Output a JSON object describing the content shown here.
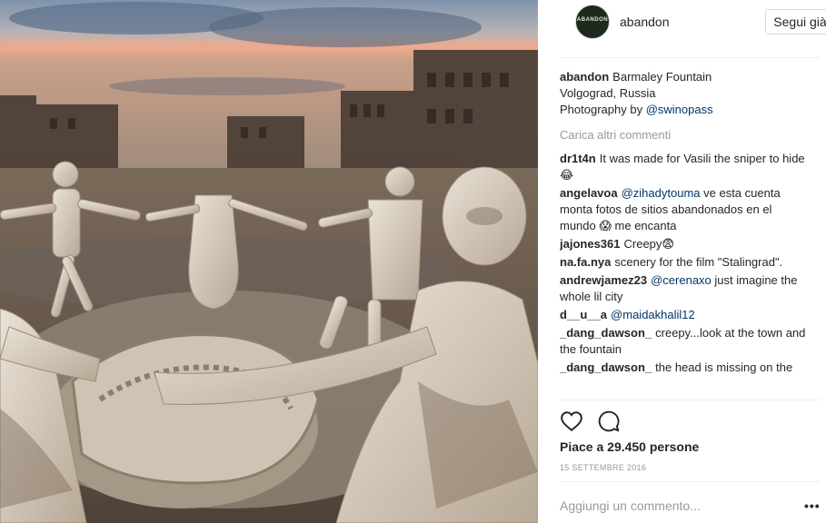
{
  "header": {
    "username": "abandon",
    "avatar_text": "ABANDON",
    "follow_label": "Segui già"
  },
  "caption": {
    "username": "abandon",
    "line1": "Barmaley Fountain",
    "line2": "Volgograd, Russia",
    "line3_prefix": "Photography by ",
    "line3_mention": "@swinopass"
  },
  "load_more": "Carica altri commenti",
  "comments": [
    {
      "user": "dr1t4n",
      "mention": "",
      "text": "It was made for Vasili the sniper to hide 😂"
    },
    {
      "user": "angelavoa",
      "mention": "@zihadytouma",
      "text": "ve esta cuenta monta fotos de sitios abandonados en el mundo 😱 me encanta"
    },
    {
      "user": "jajones361",
      "mention": "",
      "text": "Creepy😨"
    },
    {
      "user": "na.fa.nya",
      "mention": "",
      "text": "scenery for the film \"Stalingrad\"."
    },
    {
      "user": "andrewjamez23",
      "mention": "@cerenaxo",
      "text": "just imagine the whole lil city"
    },
    {
      "user": "d__u__a",
      "mention": "@maidakhalil12",
      "text": ""
    },
    {
      "user": "_dang_dawson_",
      "mention": "",
      "text": "creepy...look at the town and the fountain"
    },
    {
      "user": "_dang_dawson_",
      "mention": "",
      "text": "the head is missing on the"
    }
  ],
  "likes": "Piace a 29.450 persone",
  "date": "15 SETTEMBRE 2016",
  "add_comment_placeholder": "Aggiungi un commento...",
  "icons": {
    "like": "heart-icon",
    "comment": "comment-icon",
    "options": "more-options-icon"
  },
  "colors": {
    "text": "#262626",
    "muted": "#999999",
    "mention": "#003569",
    "border": "#efefef"
  }
}
